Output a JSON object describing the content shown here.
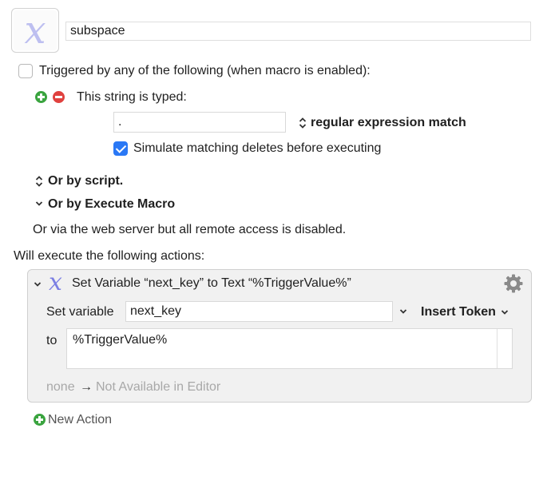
{
  "macro": {
    "icon_glyph": "x",
    "name": "subspace"
  },
  "triggers": {
    "header_label": "Triggered by any of the following (when macro is enabled):",
    "string_trigger": {
      "label": "This string is typed:",
      "value": ".",
      "match_mode": "regular expression match",
      "simulate_label": "Simulate matching deletes before executing",
      "simulate_checked": true
    },
    "by_script_label": "Or by script.",
    "by_execute_label": "Or by Execute Macro",
    "web_server_label": "Or via the web server but all remote access is disabled."
  },
  "actions": {
    "header_label": "Will execute the following actions:",
    "items": [
      {
        "title": "Set Variable “next_key” to Text “%TriggerValue%”",
        "set_variable_label": "Set variable",
        "variable_name": "next_key",
        "insert_token_label": "Insert Token",
        "to_label": "to",
        "text_value": "%TriggerValue%",
        "result_none": "none",
        "result_arrow": "→",
        "result_status": "Not Available in Editor"
      }
    ],
    "new_action_label": "New Action"
  },
  "colors": {
    "accent_blue": "#2a78f5",
    "add_green": "#3aa43f",
    "remove_red": "#e0413f",
    "icon_lavender": "#bdbff0"
  }
}
